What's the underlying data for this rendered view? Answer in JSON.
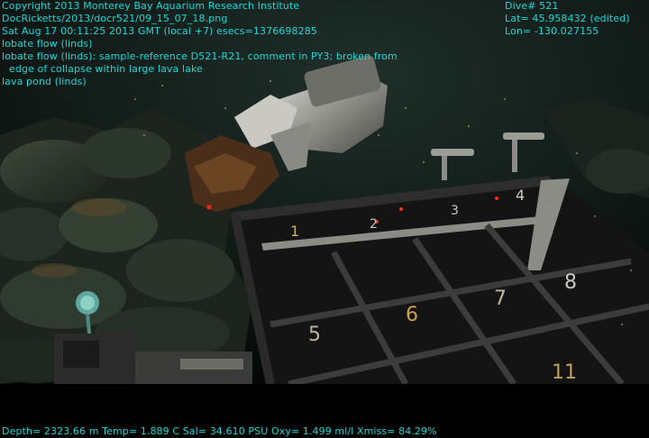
{
  "overlay": {
    "color": "#19d8d8",
    "left_lines": [
      "Copyright 2013 Monterey Bay Aquarium Research Institute",
      "DocRicketts/2013/docr521/09_15_07_18.png",
      "Sat Aug 17 00:11:25 2013 GMT (local +7)  esecs=1376698285",
      "lobate flow (linds)",
      "lobate flow (linds): sample-reference D521-R21, comment in PY3; broken from",
      "edge of collapse within large lava lake",
      "lava pond (linds)"
    ],
    "right_lines": [
      "Dive# 521",
      "Lat= 45.958432 (edited)",
      "Lon= -130.027155"
    ],
    "footer": "Depth= 2323.66 m  Temp= 1.889 C  Sal= 34.610 PSU  Oxy= 1.499 ml/l  Xmiss= 84.29%"
  },
  "tray_numbers": [
    "1",
    "2",
    "3",
    "4",
    "5",
    "6",
    "7",
    "8",
    "11"
  ]
}
